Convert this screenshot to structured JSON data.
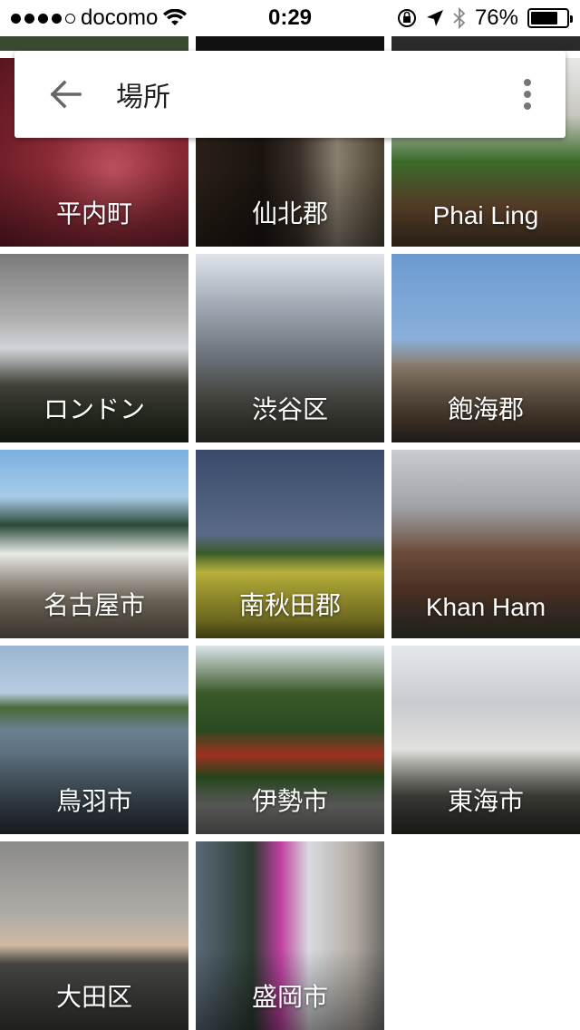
{
  "status_bar": {
    "carrier": "docomo",
    "time": "0:29",
    "battery_percent": "76%",
    "battery_level": 0.76,
    "signal_dots_filled": 4,
    "signal_dots_total": 5
  },
  "app_bar": {
    "title": "場所",
    "back_icon": "arrow-back-icon",
    "more_icon": "more-vert-icon"
  },
  "places": [
    {
      "label": "平内町"
    },
    {
      "label": "仙北郡"
    },
    {
      "label": "Phai Ling"
    },
    {
      "label": "ロンドン"
    },
    {
      "label": "渋谷区"
    },
    {
      "label": "飽海郡"
    },
    {
      "label": "名古屋市"
    },
    {
      "label": "南秋田郡"
    },
    {
      "label": "Khan Ham"
    },
    {
      "label": "鳥羽市"
    },
    {
      "label": "伊勢市"
    },
    {
      "label": "東海市"
    },
    {
      "label": "大田区"
    },
    {
      "label": "盛岡市"
    }
  ]
}
